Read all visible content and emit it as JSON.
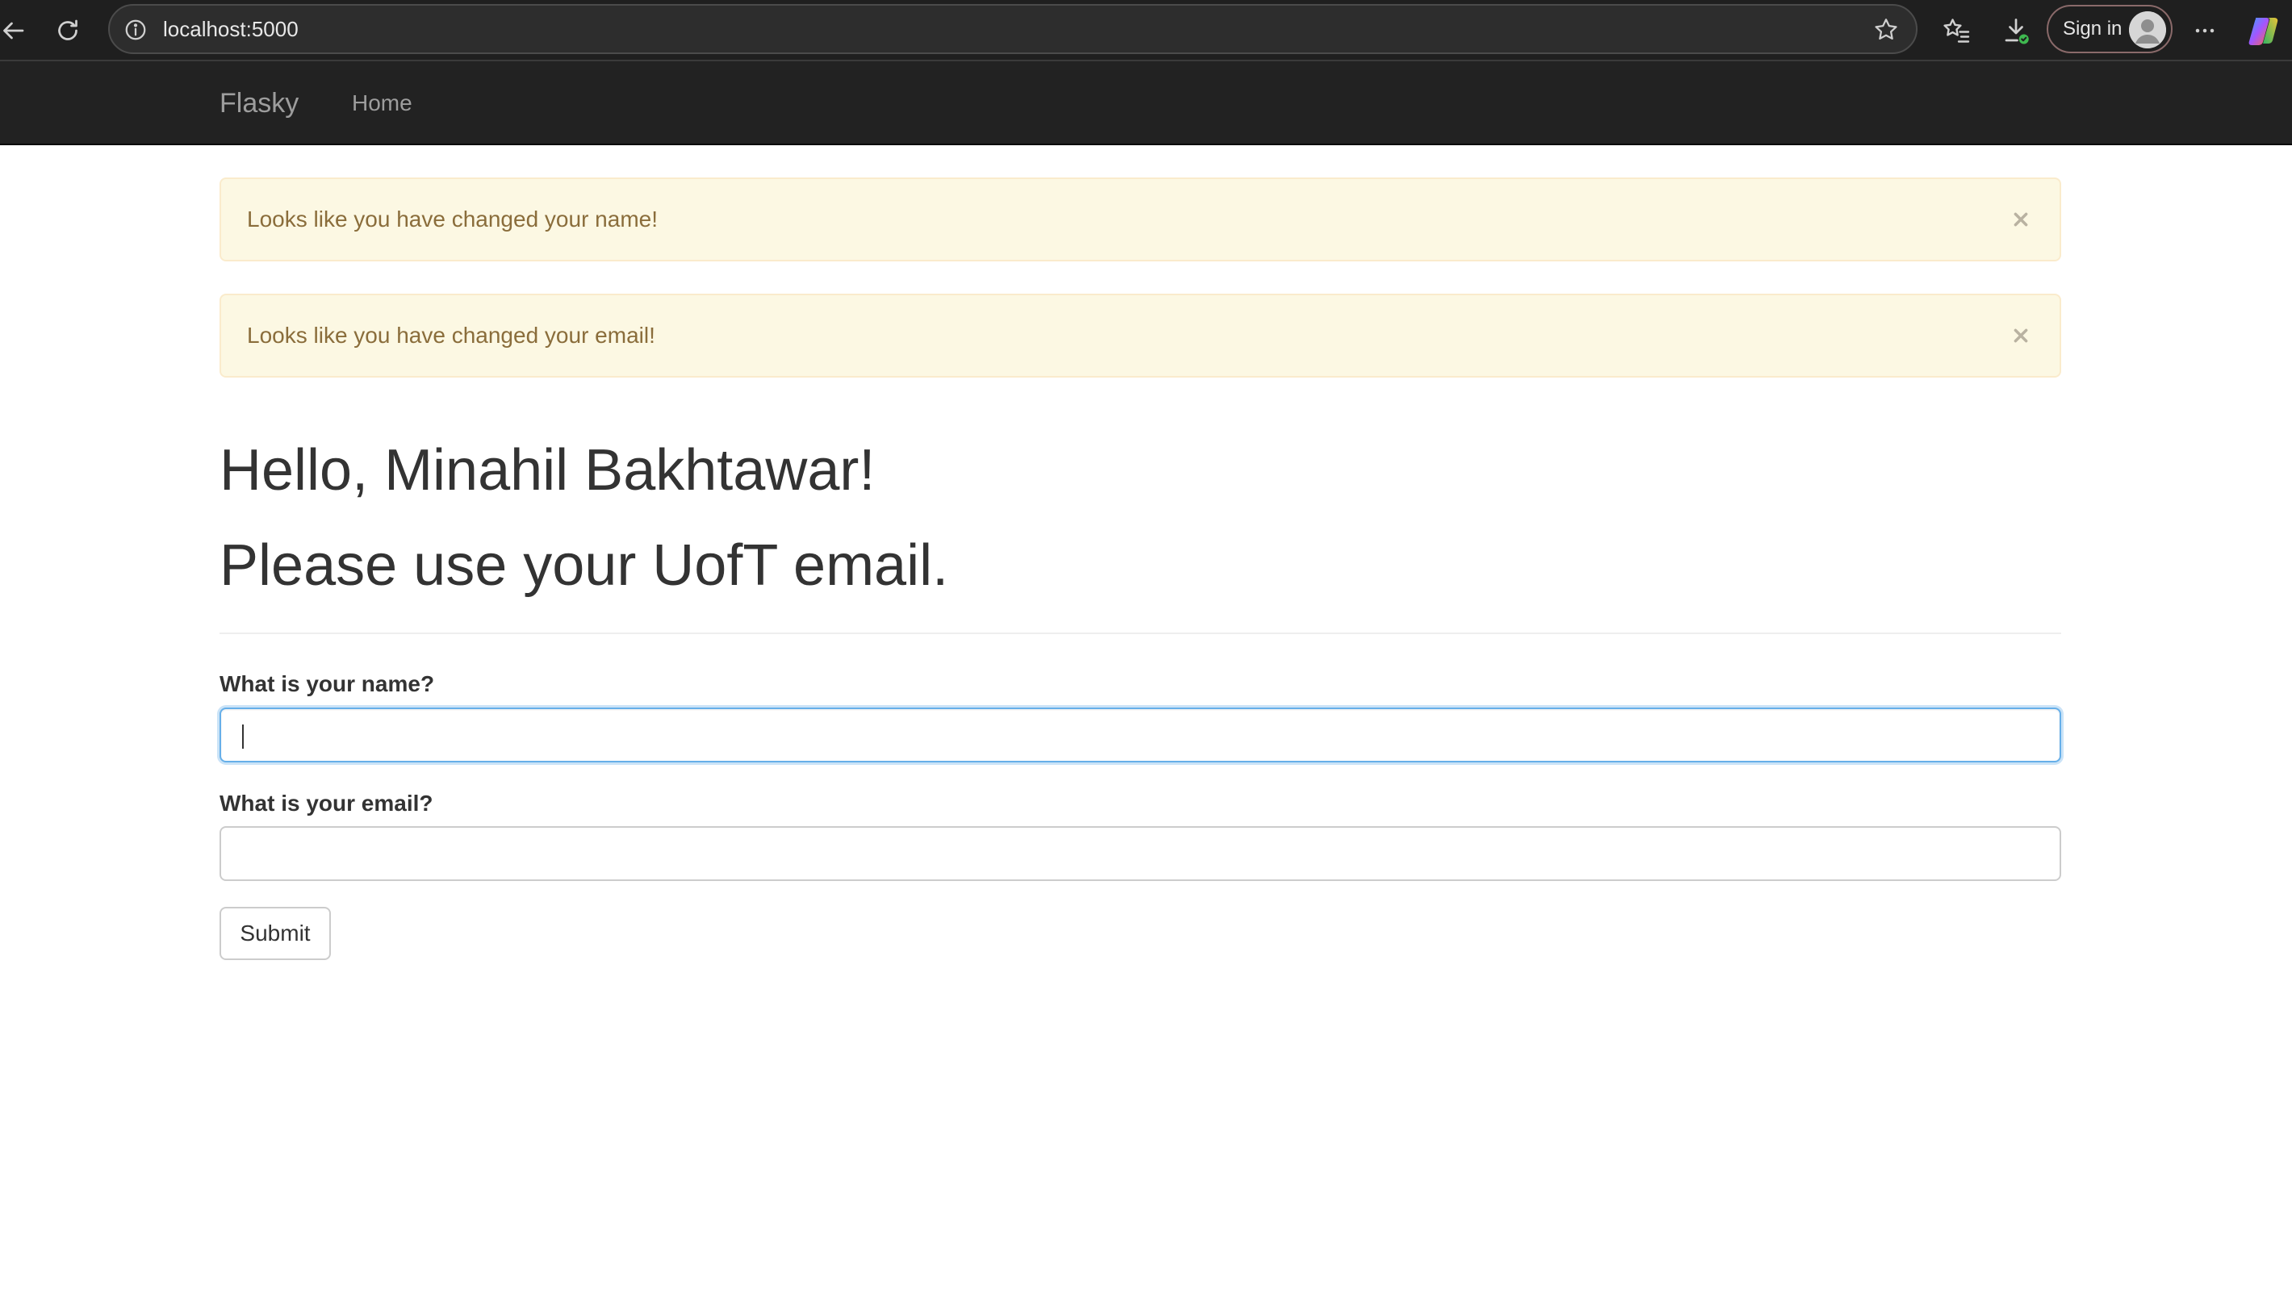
{
  "browser": {
    "url": "localhost:5000",
    "sign_in_label": "Sign in",
    "icons": [
      "back-arrow-icon",
      "reload-icon",
      "info-icon",
      "star-icon",
      "favorites-icon",
      "downloads-icon",
      "more-icon",
      "copilot-icon"
    ]
  },
  "navbar": {
    "brand": "Flasky",
    "links": [
      {
        "label": "Home"
      }
    ]
  },
  "alerts": [
    {
      "message": "Looks like you have changed your name!",
      "close": "×"
    },
    {
      "message": "Looks like you have changed your email!",
      "close": "×"
    }
  ],
  "page": {
    "greeting": "Hello, Minahil Bakhtawar!",
    "subtitle": "Please use your UofT email."
  },
  "form": {
    "name_label": "What is your name?",
    "name_value": "",
    "email_label": "What is your email?",
    "email_value": "",
    "submit_label": "Submit"
  },
  "colors": {
    "navbar_bg": "#222222",
    "alert_bg": "#fcf8e3",
    "alert_text": "#8a6d3b",
    "focus_border": "#66afe9"
  }
}
